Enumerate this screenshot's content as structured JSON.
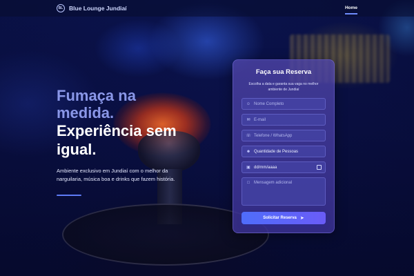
{
  "nav": {
    "brand": "Blue Lounge Jundiaí",
    "logo_text": "BL",
    "link_home": "Home"
  },
  "hero": {
    "title_line1": "Fumaça na",
    "title_line2": "medida.",
    "title_line3": "Experiência sem",
    "title_line4": "igual.",
    "subtitle": "Ambiente exclusivo em Jundiaí com o melhor da narguilaria, música boa e drinks que fazem história."
  },
  "form": {
    "title": "Faça sua Reserva",
    "description": "Escolha a data e garanta sua vaga no melhor ambiente de Jundiaí",
    "name_placeholder": "Nome Completo",
    "email_placeholder": "E-mail",
    "phone_placeholder": "Telefone / WhatsApp",
    "people_select": "Quantidade de Pessoas",
    "date_value": "dd/mm/aaaa",
    "message_placeholder": "Mensagem adicional",
    "submit_label": "Solicitar Reserva"
  },
  "icons": {
    "user": "user-icon",
    "email": "envelope-icon",
    "phone": "phone-icon",
    "people": "people-icon",
    "calendar": "calendar-icon",
    "message": "message-icon",
    "send": "send-icon"
  },
  "colors": {
    "accent": "#5f7cf7",
    "title_muted": "#8a97e8",
    "card": "#4f46a8"
  }
}
